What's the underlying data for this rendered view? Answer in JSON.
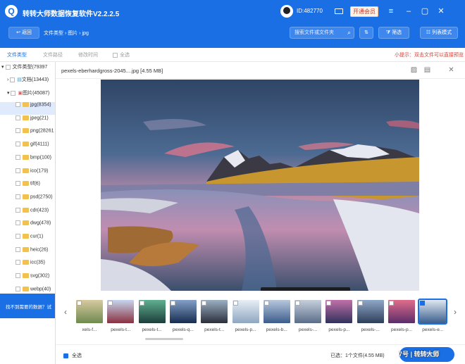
{
  "app": {
    "title": "转转大师数据恢复软件V2.2.2.5",
    "user_id": "ID:482770",
    "vip_label": "开通会员"
  },
  "toolbar": {
    "back_label": "返回",
    "breadcrumb": [
      "文件类型",
      "图片",
      "jpg"
    ],
    "search_placeholder": "搜索文件或文件夹",
    "filter_label": "筛选",
    "view_mode_label": "列表模式"
  },
  "tabs": {
    "file_type": "文件类型",
    "file_path": "文件路径",
    "modified": "修改时间",
    "select_all": "全选"
  },
  "tip": "小提示：双击文件可以直接预览",
  "tree": {
    "root": "文件类型(79397",
    "docs": "文档(13443)",
    "images": "图片(45087)",
    "items": [
      {
        "label": "jpg(8354)"
      },
      {
        "label": "jpeg(21)"
      },
      {
        "label": "png(28261"
      },
      {
        "label": "gif(4111)"
      },
      {
        "label": "bmp(100)"
      },
      {
        "label": "ico(179)"
      },
      {
        "label": "tif(6)"
      },
      {
        "label": "psd(2750)"
      },
      {
        "label": "cdr(423)"
      },
      {
        "label": "dwg(478)"
      },
      {
        "label": "cur(1)"
      },
      {
        "label": "heic(26)"
      },
      {
        "label": "icc(35)"
      },
      {
        "label": "svg(302)"
      },
      {
        "label": "webp(40)"
      }
    ]
  },
  "left_footer": "找不到需要的数据？试",
  "preview": {
    "title": "pexels-eberhardgross-2045....jpg [4.55 MB]",
    "thumbs": [
      {
        "label": "xels-f..."
      },
      {
        "label": "pexels-t..."
      },
      {
        "label": "pexels-t..."
      },
      {
        "label": "pexels-q..."
      },
      {
        "label": "pexels-t..."
      },
      {
        "label": "pexels-p..."
      },
      {
        "label": "pexels-b..."
      },
      {
        "label": "pexels-..."
      },
      {
        "label": "pexels-p..."
      },
      {
        "label": "pexels-..."
      },
      {
        "label": "pexels-p..."
      },
      {
        "label": "pexels-e..."
      }
    ],
    "select_all": "全选",
    "status": "已选：1个文件(4.55 MB)",
    "recover_label": "立即恢复"
  },
  "watermark": "7号 | 转转大师",
  "colors": {
    "brand": "#1a6fe5",
    "tip": "#d14036"
  }
}
